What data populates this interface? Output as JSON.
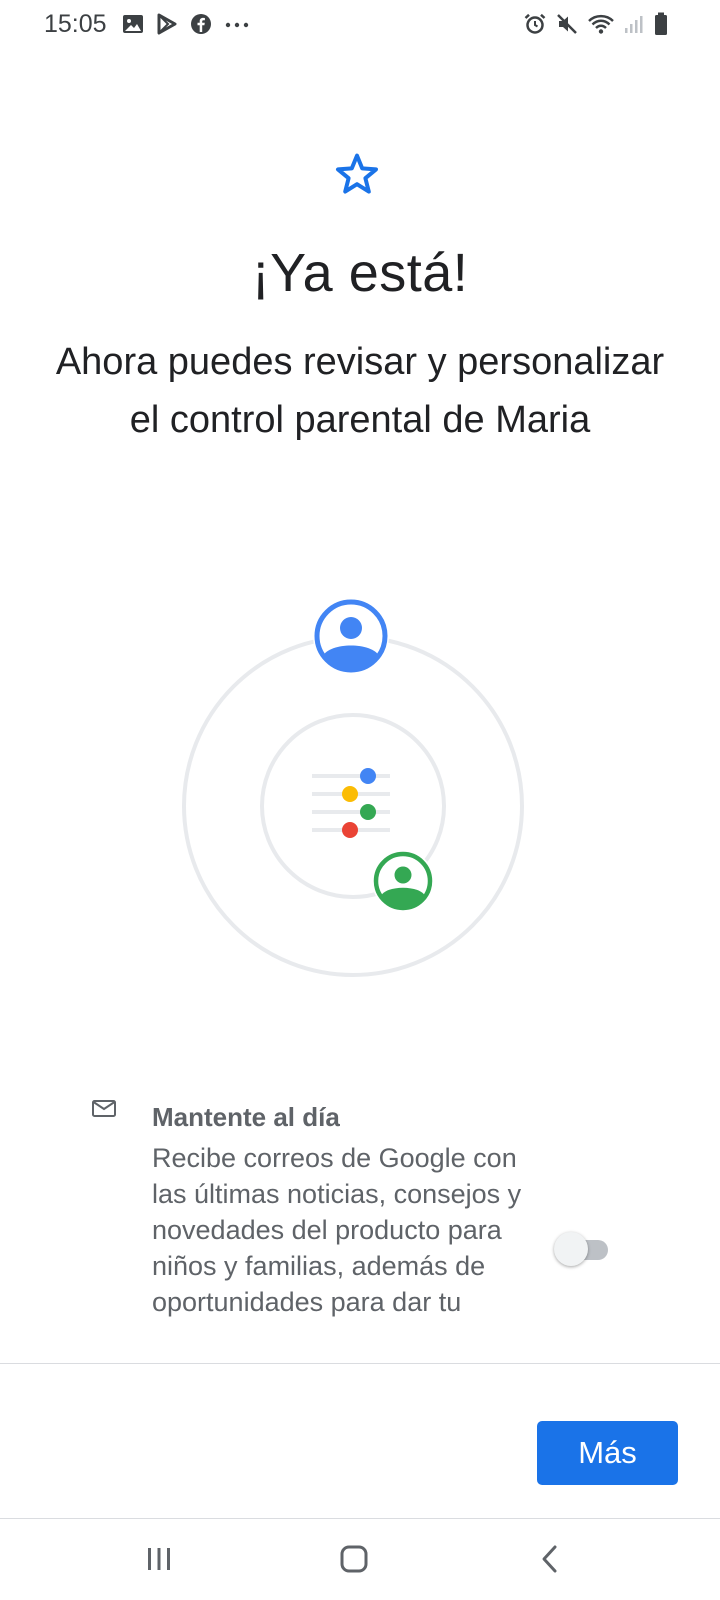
{
  "status_bar": {
    "time": "15:05",
    "left_icons": [
      "gallery-icon",
      "play-store-icon",
      "facebook-icon",
      "more-dots-icon"
    ],
    "right_icons": [
      "alarm-icon",
      "mute-icon",
      "wifi-icon",
      "signal-icon",
      "battery-icon"
    ]
  },
  "header": {
    "icon": "star-icon",
    "title": "¡Ya está!",
    "subtitle": "Ahora puedes revisar y personalizar el control parental de Maria"
  },
  "illustration": {
    "icons": [
      "parent-avatar-icon",
      "settings-sliders-icon",
      "child-avatar-icon"
    ],
    "colors": {
      "blue": "#4285f4",
      "yellow": "#fbbc04",
      "green": "#34a853",
      "red": "#ea4335",
      "ring": "#e8eaed"
    }
  },
  "newsletter": {
    "icon": "mail-icon",
    "title": "Mantente al día",
    "description": "Recibe correos de Google con las últimas noticias, consejos y novedades del producto para niños y familias, además de oportunidades para dar tu",
    "toggle_on": false
  },
  "footer": {
    "more_label": "Más",
    "accent_color": "#1a73e8"
  },
  "nav_bar": {
    "icons": [
      "recents-icon",
      "home-icon",
      "back-icon"
    ]
  }
}
